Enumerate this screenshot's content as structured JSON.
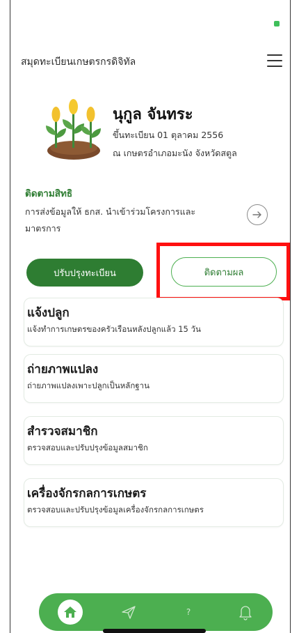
{
  "app": {
    "title": "สมุดทะเบียนเกษตรกรดิจิทัล"
  },
  "profile": {
    "name": "นุกูล จันทระ",
    "registered": "ขึ้นทะเบียน 01 ตุลาคม 2556",
    "location": "ณ เกษตรอำเภอมะนัง จังหวัดสตูล"
  },
  "tracking": {
    "title": "ติดตามสิทธิ",
    "description": "การส่งข้อมูลให้ ธกส. นำเข้าร่วมโครงการและมาตรการ"
  },
  "actions": {
    "update_label": "ปรับปรุงทะเบียน",
    "follow_label": "ติดตามผล"
  },
  "cards": [
    {
      "title": "แจ้งปลูก",
      "subtitle": "แจ้งทำการเกษตรของครัวเรือนหลังปลูกแล้ว 15 วัน"
    },
    {
      "title": "ถ่ายภาพแปลง",
      "subtitle": "ถ่ายภาพแปลงเพาะปลูกเป็นหลักฐาน"
    },
    {
      "title": "สำรวจสมาชิก",
      "subtitle": "ตรวจสอบและปรับปรุงข้อมูลสมาชิก"
    },
    {
      "title": "เครื่องจักรกลการเกษตร",
      "subtitle": "ตรวจสอบและปรับปรุงข้อมูลเครื่องจักรกลการเกษตร"
    }
  ],
  "nav": {
    "help_label": "?",
    "icons": [
      "home-icon",
      "send-icon",
      "help-icon",
      "bell-icon"
    ]
  },
  "colors": {
    "primary": "#2e7d32",
    "nav": "#4caf50",
    "highlight": "#ff1010"
  }
}
